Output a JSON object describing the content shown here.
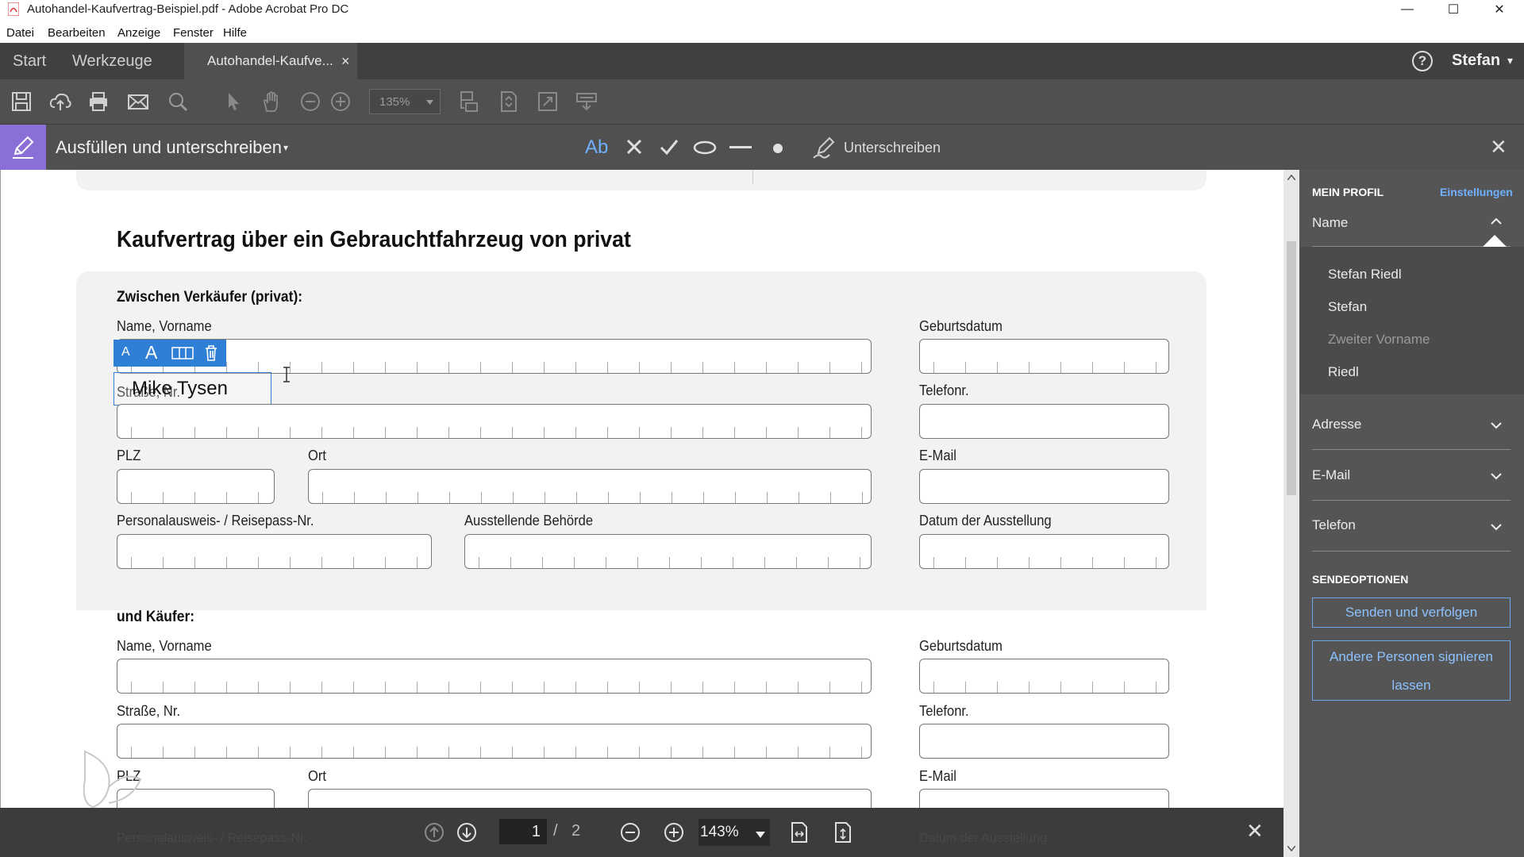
{
  "window": {
    "title": "Autohandel-Kaufvertrag-Beispiel.pdf - Adobe Acrobat Pro DC",
    "minimize_glyph": "—",
    "maximize_glyph": "☐",
    "close_glyph": "✕"
  },
  "menu": [
    "Datei",
    "Bearbeiten",
    "Anzeige",
    "Fenster",
    "Hilfe"
  ],
  "tabs": {
    "start": "Start",
    "tools": "Werkzeuge",
    "document": "Autohandel-Kaufve...",
    "close_glyph": "×",
    "user": "Stefan",
    "help_glyph": "?",
    "caret": "▾"
  },
  "toolbar": {
    "zoom": "135%",
    "icons": [
      "save-icon",
      "cloud-upload-icon",
      "print-icon",
      "mail-icon",
      "search-icon",
      "select-pointer-icon",
      "hand-icon",
      "zoom-out-icon",
      "zoom-in-icon"
    ]
  },
  "fillsign": {
    "label": "Ausfüllen und unterschreiben",
    "caret": "▾",
    "tool_text": "Ab",
    "sign_label": "Unterschreiben",
    "close_glyph": "✕"
  },
  "text_tools": {
    "small": "A",
    "large": "A"
  },
  "document": {
    "heading": "Kaufvertrag über ein Gebrauchtfahrzeug von privat",
    "seller_section": "Zwischen Verkäufer (privat):",
    "buyer_section": "und Käufer:",
    "labels": {
      "name": "Name, Vorname",
      "birth": "Geburtsdatum",
      "street": "Straße, Nr.",
      "phone": "Telefonr.",
      "zip": "PLZ",
      "city": "Ort",
      "email": "E-Mail",
      "id": "Personalausweis- / Reisepass-Nr.",
      "authority": "Ausstellende Behörde",
      "issue_date": "Datum der Ausstellung"
    },
    "typed_text": "Mike Tysen",
    "cut_label_1": "Personalausweis- / Reisepass-Nr.",
    "cut_label_2": "Datum der Ausstellung"
  },
  "profile": {
    "header": "MEIN PROFIL",
    "settings": "Einstellungen",
    "name_label": "Name",
    "name_values": [
      "Stefan Riedl",
      "Stefan",
      "Zweiter Vorname",
      "Riedl"
    ],
    "address": "Adresse",
    "email": "E-Mail",
    "phone": "Telefon",
    "send_header": "SENDEOPTIONEN",
    "send_button": "Senden und verfolgen",
    "others_button_1": "Andere Personen signieren",
    "others_button_2": "lassen"
  },
  "nav": {
    "page_current": "1",
    "page_sep": "/",
    "page_total": "2",
    "zoom": "143%",
    "close_glyph": "✕"
  }
}
